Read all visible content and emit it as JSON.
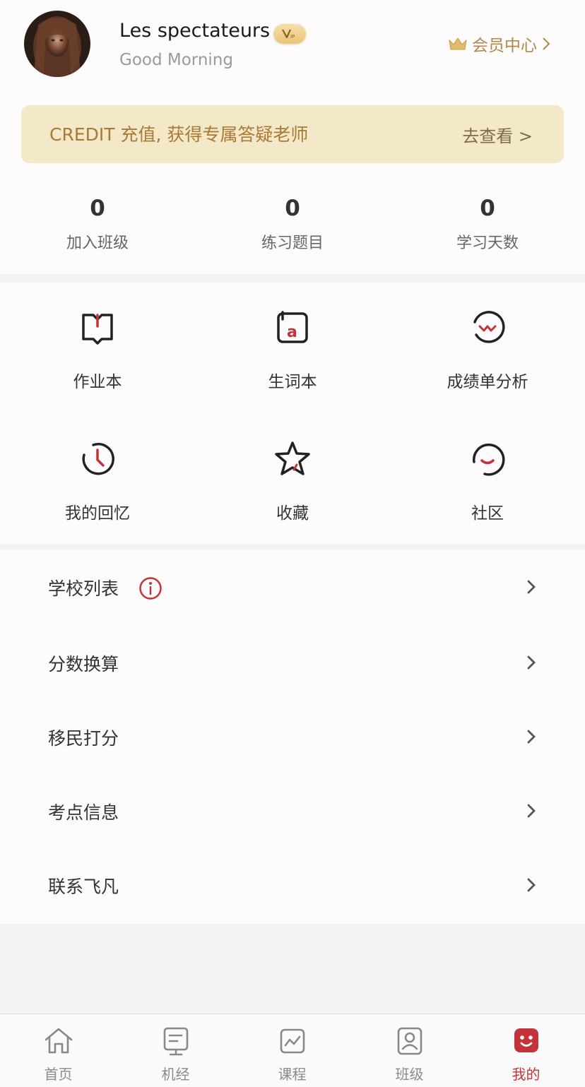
{
  "profile": {
    "username": "Les spectateurs",
    "greeting": "Good Morning",
    "member_center": "会员中心"
  },
  "banner": {
    "text": "CREDIT 充值, 获得专属答疑老师",
    "link": "去查看 >"
  },
  "stats": [
    {
      "value": "0",
      "label": "加入班级"
    },
    {
      "value": "0",
      "label": "练习题目"
    },
    {
      "value": "0",
      "label": "学习天数"
    }
  ],
  "grid": [
    {
      "label": "作业本",
      "icon": "book-icon"
    },
    {
      "label": "生词本",
      "icon": "vocab-icon"
    },
    {
      "label": "成绩单分析",
      "icon": "analysis-icon"
    },
    {
      "label": "我的回忆",
      "icon": "clock-icon"
    },
    {
      "label": "收藏",
      "icon": "star-icon"
    },
    {
      "label": "社区",
      "icon": "smile-icon"
    }
  ],
  "list": [
    {
      "label": "学校列表"
    },
    {
      "label": "分数换算"
    },
    {
      "label": "移民打分"
    },
    {
      "label": "考点信息"
    },
    {
      "label": "联系飞凡"
    }
  ],
  "tabbar": [
    {
      "label": "首页",
      "icon": "home-icon"
    },
    {
      "label": "机经",
      "icon": "document-icon"
    },
    {
      "label": "课程",
      "icon": "course-icon"
    },
    {
      "label": "班级",
      "icon": "class-icon"
    },
    {
      "label": "我的",
      "icon": "me-icon",
      "active": true
    }
  ],
  "colors": {
    "accent": "#c2343a",
    "gold": "#b08a48",
    "banner_bg": "#f3e8c8"
  }
}
